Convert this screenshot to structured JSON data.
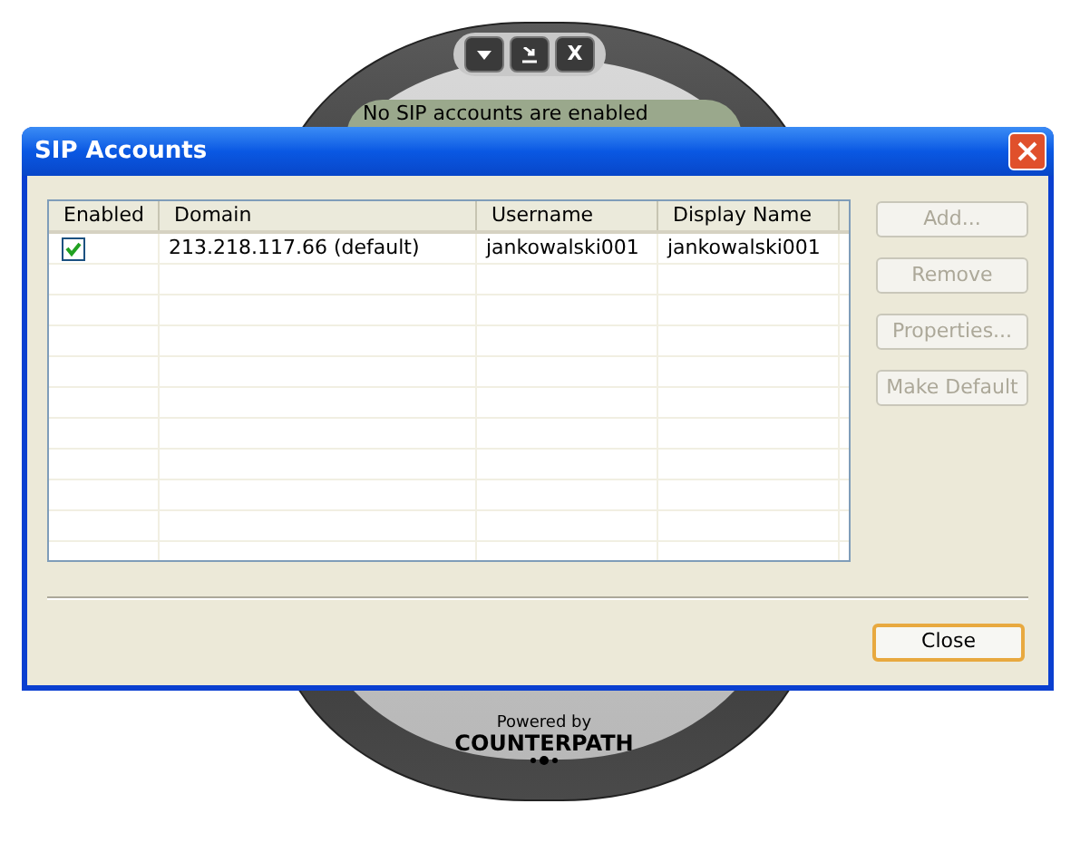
{
  "background_app": {
    "status_text": "No SIP accounts are enabled",
    "top_buttons": [
      {
        "kind": "menu"
      },
      {
        "kind": "minimize"
      },
      {
        "kind": "text",
        "label": "X"
      }
    ],
    "powered_by": "Powered by",
    "brand": "COUNTERPATH"
  },
  "dialog": {
    "title": "SIP Accounts",
    "table": {
      "columns": [
        "Enabled",
        "Domain",
        "Username",
        "Display Name"
      ],
      "rows": [
        {
          "enabled": true,
          "domain": "213.218.117.66 (default)",
          "username": "jankowalski001",
          "display_name": "jankowalski001"
        }
      ]
    },
    "side_buttons": [
      {
        "label": "Add...",
        "disabled": true
      },
      {
        "label": "Remove",
        "disabled": true
      },
      {
        "label": "Properties...",
        "disabled": true
      },
      {
        "label": "Make Default",
        "disabled": true
      }
    ],
    "close_button": {
      "label": "Close",
      "default": true
    }
  }
}
